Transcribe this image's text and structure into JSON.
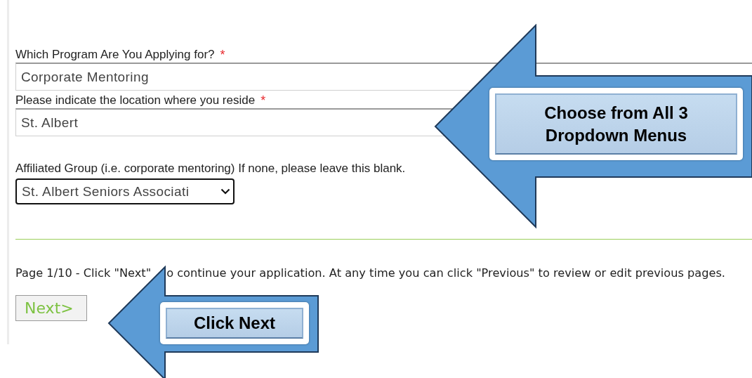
{
  "form": {
    "fields": [
      {
        "kind": "wide_select",
        "label": "Which Program Are You Applying for?",
        "required_mark": "*",
        "value": "Corporate Mentoring"
      },
      {
        "kind": "wide_select",
        "label": "Please indicate the location where you reside",
        "required_mark": "*",
        "value": "St. Albert"
      },
      {
        "kind": "compact_select",
        "label": "Affiliated Group (i.e. corporate mentoring) If none, please leave this blank.",
        "value": "St. Albert Seniors Associati"
      }
    ]
  },
  "footer": {
    "instruction_before": "Page 1/10 - Click \"Next\"",
    "instruction_after": "o continue your application. At any time you can click \"Previous\" to review or edit previous pages.",
    "next_button": "Next>"
  },
  "callouts": [
    {
      "kind": "large",
      "text": "Choose from All 3 Dropdown Menus"
    },
    {
      "kind": "small",
      "text": "Click Next"
    }
  ]
}
